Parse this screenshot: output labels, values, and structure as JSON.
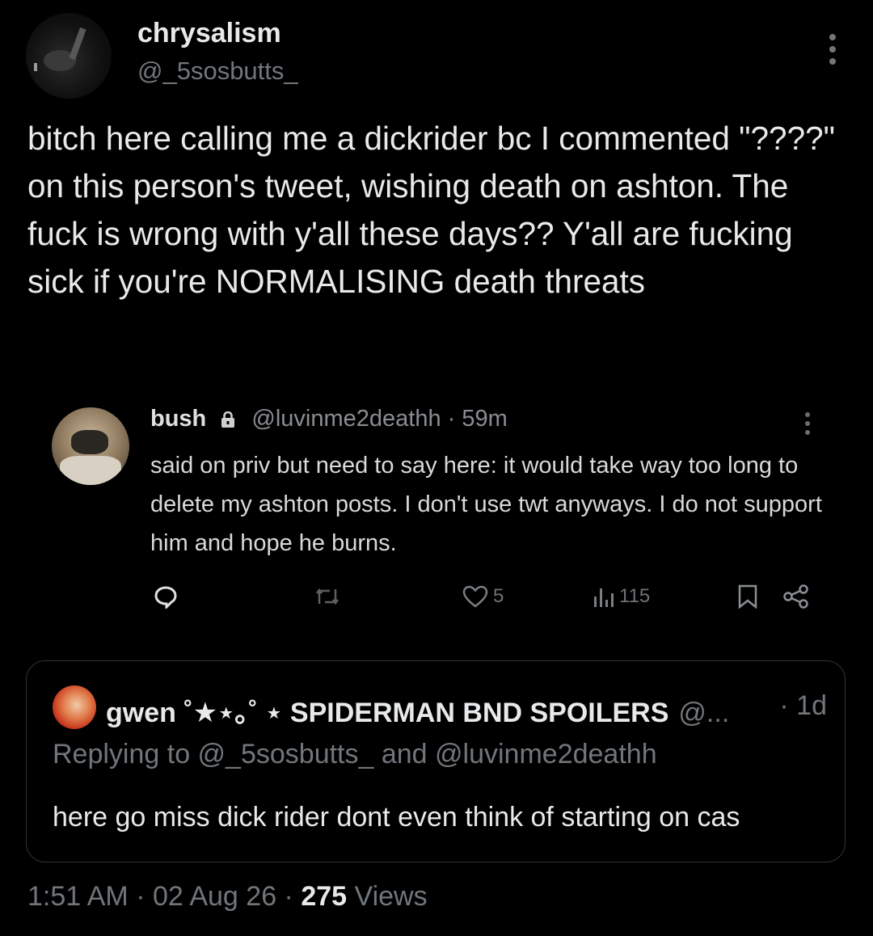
{
  "author": {
    "display_name": "chrysalism",
    "handle": "@_5sosbutts_"
  },
  "tweet": {
    "text": "bitch here calling me a dickrider bc I commented \"????\" on this person's tweet, wishing death on ashton. The fuck is wrong with y'all these days?? Y'all are fucking sick if you're NORMALISING death threats"
  },
  "embedded": {
    "display_name": "bush",
    "handle_time": "@luvinme2deathh · 59m",
    "text": "said on priv but need to say here: it would take way too long to delete my ashton posts. I don't use twt anyways. I do not support him and hope he burns.",
    "likes": "5",
    "views": "115"
  },
  "quote": {
    "display_name": "gwen ˚★⋆｡˚ ⋆ SPIDERMAN BND SPOILERS",
    "handle": "@...",
    "time": "· 1d",
    "replying": "Replying to @_5sosbutts_ and @luvinme2deathh",
    "text": "here go miss dick rider dont even think of starting on cas"
  },
  "meta": {
    "timestamp": "1:51 AM · 02 Aug 26 · ",
    "views_count": "275",
    "views_label": " Views"
  },
  "colors": {
    "background": "#000000",
    "primary_text": "#e7e9ea",
    "secondary_text": "#71767b",
    "border": "#2f3336"
  }
}
